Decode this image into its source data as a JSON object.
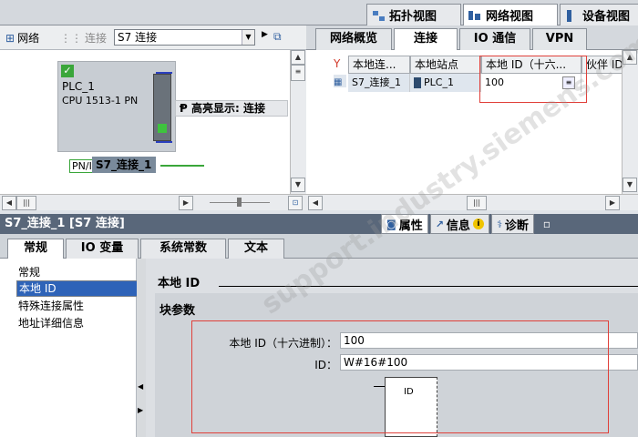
{
  "view_tabs": {
    "topology": "拓扑视图",
    "network": "网络视图",
    "device": "设备视图"
  },
  "toolbar": {
    "network_label": "网络",
    "connection_label": "连接",
    "connection_type": "S7 连接"
  },
  "canvas": {
    "device_name": "PLC_1",
    "device_model": "CPU 1513-1 PN",
    "highlight_label": "高亮显示: 连接",
    "port_label": "PN/I",
    "connection_label": "S7_连接_1"
  },
  "right_tabs": [
    "网络概览",
    "连接",
    "IO 通信",
    "VPN"
  ],
  "grid": {
    "headers": [
      "本地连...",
      "本地站点",
      "本地 ID（十六...",
      "伙伴 ID（十"
    ],
    "rows": [
      {
        "name": "S7_连接_1",
        "station": "PLC_1",
        "local_id": "100"
      }
    ]
  },
  "inspector": {
    "title": "S7_连接_1 [S7 连接]",
    "tabs": [
      "属性",
      "信息",
      "诊断"
    ],
    "sub_tabs": [
      "常规",
      "IO 变量",
      "系统常数",
      "文本"
    ],
    "nav": [
      "常规",
      "本地 ID",
      "特殊连接属性",
      "地址详细信息"
    ],
    "section_title": "本地 ID",
    "group_title": "块参数",
    "fields": {
      "local_id_label": "本地 ID（十六进制）：",
      "local_id_value": "100",
      "id_label": "ID：",
      "id_value": "W#16#100",
      "block_pin": "ID"
    }
  },
  "watermark": "support.industry.siemens.com/cs"
}
